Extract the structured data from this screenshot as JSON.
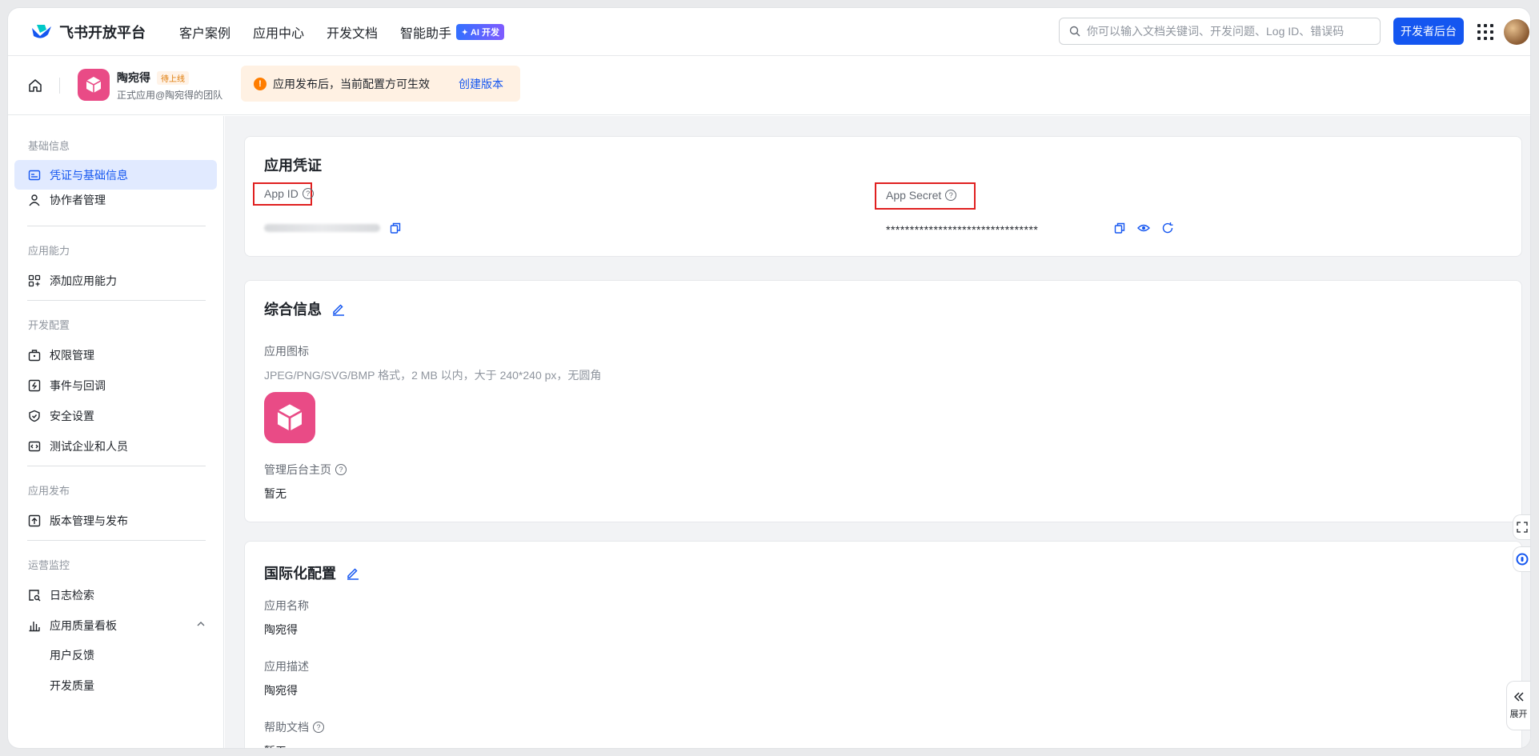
{
  "brand": {
    "name": "飞书开放平台"
  },
  "nav": {
    "items": [
      {
        "label": "客户案例"
      },
      {
        "label": "应用中心"
      },
      {
        "label": "开发文档"
      },
      {
        "label": "智能助手"
      }
    ],
    "ai_badge": "✦ AI 开发"
  },
  "search": {
    "placeholder": "你可以输入文档关键词、开发问题、Log ID、错误码"
  },
  "dev_console_button": "开发者后台",
  "app": {
    "name": "陶宛得",
    "status": "待上线",
    "subtitle": "正式应用@陶宛得的团队"
  },
  "notice": {
    "text": "应用发布后，当前配置方可生效",
    "link": "创建版本"
  },
  "sidebar": {
    "sections": [
      {
        "title": "基础信息",
        "items": [
          "凭证与基础信息",
          "协作者管理"
        ]
      },
      {
        "title": "应用能力",
        "items": [
          "添加应用能力"
        ]
      },
      {
        "title": "开发配置",
        "items": [
          "权限管理",
          "事件与回调",
          "安全设置",
          "测试企业和人员"
        ]
      },
      {
        "title": "应用发布",
        "items": [
          "版本管理与发布"
        ]
      },
      {
        "title": "运营监控",
        "items": [
          "日志检索",
          "应用质量看板"
        ],
        "subitems": [
          "用户反馈",
          "开发质量"
        ]
      }
    ]
  },
  "credentials": {
    "title": "应用凭证",
    "app_id_label": "App ID",
    "app_secret_label": "App Secret",
    "app_secret_value": "********************************"
  },
  "general": {
    "title": "综合信息",
    "icon_label": "应用图标",
    "icon_hint": "JPEG/PNG/SVG/BMP 格式，2 MB 以内，大于 240*240 px，无圆角",
    "admin_label": "管理后台主页",
    "admin_value": "暂无"
  },
  "i18n": {
    "title": "国际化配置",
    "name_label": "应用名称",
    "name_value": "陶宛得",
    "desc_label": "应用描述",
    "desc_value": "陶宛得",
    "help_label": "帮助文档",
    "help_value": "暂无"
  },
  "expand_label": "展开",
  "colors": {
    "primary": "#1456f0",
    "app_icon": "#e94b86",
    "highlight_box": "#e02020",
    "notice_bg": "#fff1e3"
  }
}
